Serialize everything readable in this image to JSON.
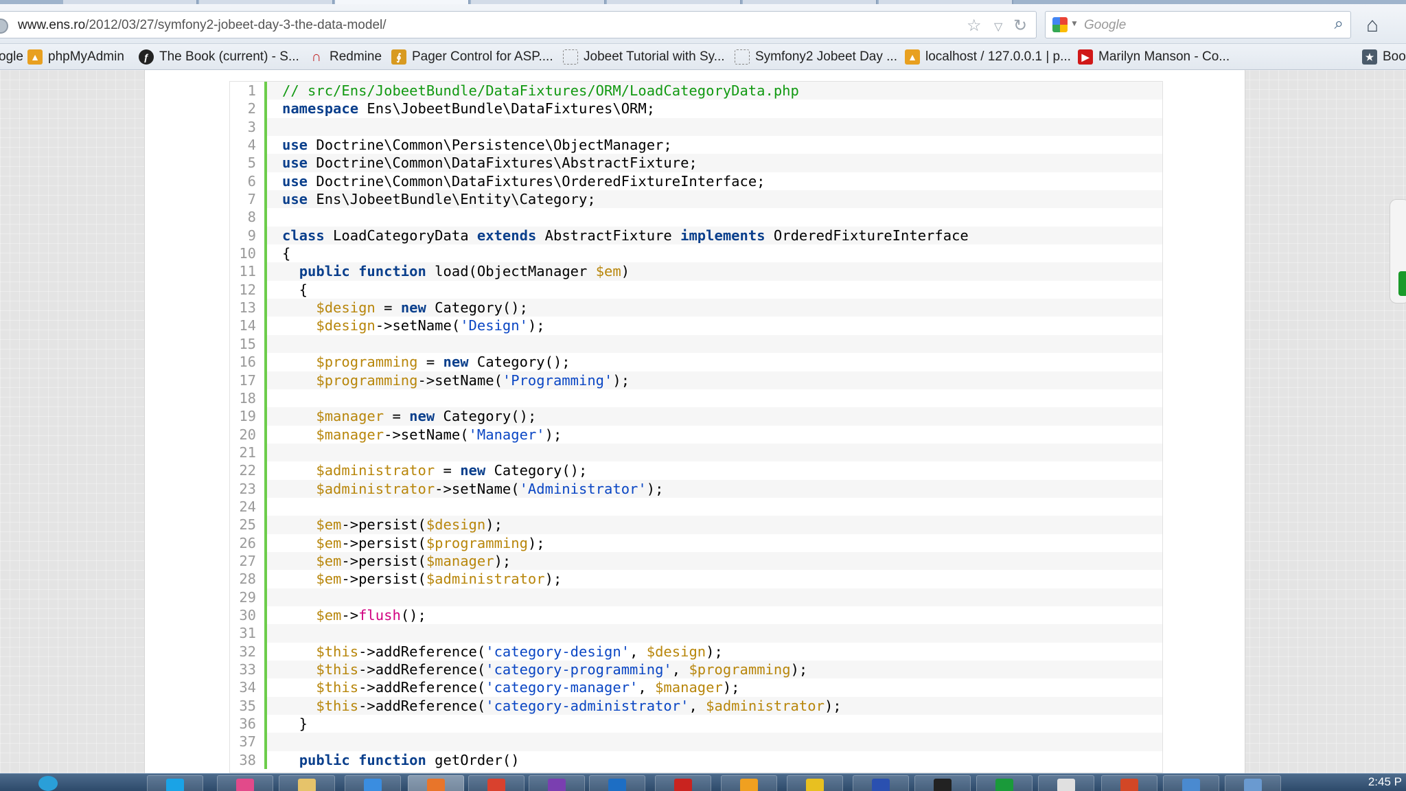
{
  "browser": {
    "url_host": "www.ens.ro",
    "url_path": "/2012/03/27/symfony2-jobeet-day-3-the-data-model/",
    "search_placeholder": "Google"
  },
  "bookmarks": [
    {
      "label": "ogle",
      "icon": "google-icon"
    },
    {
      "label": "phpMyAdmin",
      "icon": "phpmyadmin-icon"
    },
    {
      "label": "The Book (current) - S...",
      "icon": "symfony-icon"
    },
    {
      "label": "Redmine",
      "icon": "redmine-icon"
    },
    {
      "label": "Pager Control for ASP....",
      "icon": "pager-icon"
    },
    {
      "label": "Jobeet Tutorial with Sy...",
      "icon": "page-icon"
    },
    {
      "label": "Symfony2 Jobeet Day ...",
      "icon": "page-icon"
    },
    {
      "label": "localhost / 127.0.0.1 | p...",
      "icon": "phpmyadmin-icon"
    },
    {
      "label": "Marilyn Manson - Co...",
      "icon": "youtube-icon"
    },
    {
      "label": "Boo",
      "icon": "bookmarks-icon"
    }
  ],
  "code": {
    "start_line": 1,
    "lines": [
      "// src/Ens/JobeetBundle/DataFixtures/ORM/LoadCategoryData.php",
      "namespace Ens\\JobeetBundle\\DataFixtures\\ORM;",
      "",
      "use Doctrine\\Common\\Persistence\\ObjectManager;",
      "use Doctrine\\Common\\DataFixtures\\AbstractFixture;",
      "use Doctrine\\Common\\DataFixtures\\OrderedFixtureInterface;",
      "use Ens\\JobeetBundle\\Entity\\Category;",
      "",
      "class LoadCategoryData extends AbstractFixture implements OrderedFixtureInterface",
      "{",
      "  public function load(ObjectManager $em)",
      "  {",
      "    $design = new Category();",
      "    $design->setName('Design');",
      "",
      "    $programming = new Category();",
      "    $programming->setName('Programming');",
      "",
      "    $manager = new Category();",
      "    $manager->setName('Manager');",
      "",
      "    $administrator = new Category();",
      "    $administrator->setName('Administrator');",
      "",
      "    $em->persist($design);",
      "    $em->persist($programming);",
      "    $em->persist($manager);",
      "    $em->persist($administrator);",
      "",
      "    $em->flush();",
      "",
      "    $this->addReference('category-design', $design);",
      "    $this->addReference('category-programming', $programming);",
      "    $this->addReference('category-manager', $manager);",
      "    $this->addReference('category-administrator', $administrator);",
      "  }",
      "",
      "  public function getOrder()"
    ]
  },
  "taskbar": {
    "clock": "2:45 P",
    "items": [
      {
        "icon": "skype-icon",
        "color": "#1aa3e6"
      },
      {
        "icon": "app-icon",
        "color": "#e24a8a"
      },
      {
        "icon": "folder-icon",
        "color": "#e6c36a"
      },
      {
        "icon": "ie-icon",
        "color": "#3a8de0"
      },
      {
        "icon": "firefox-icon",
        "color": "#e8752a"
      },
      {
        "icon": "chrome-icon",
        "color": "#d9412e"
      },
      {
        "icon": "visual-studio-icon",
        "color": "#7a3fb0"
      },
      {
        "icon": "outlook-icon",
        "color": "#1d6ec4"
      },
      {
        "icon": "filezilla-icon",
        "color": "#c9231f"
      },
      {
        "icon": "star-app-icon",
        "color": "#f0a020"
      },
      {
        "icon": "notes-icon",
        "color": "#e8c020"
      },
      {
        "icon": "document-icon",
        "color": "#2a50b0"
      },
      {
        "icon": "terminal-icon",
        "color": "#222222"
      },
      {
        "icon": "green-app-icon",
        "color": "#1a9a3a"
      },
      {
        "icon": "chart-app-icon",
        "color": "#e0e0e0"
      },
      {
        "icon": "powerpoint-icon",
        "color": "#d24726"
      },
      {
        "icon": "window-app-icon",
        "color": "#4a8ad0"
      },
      {
        "icon": "window-app-icon",
        "color": "#6a9ad0"
      }
    ]
  }
}
